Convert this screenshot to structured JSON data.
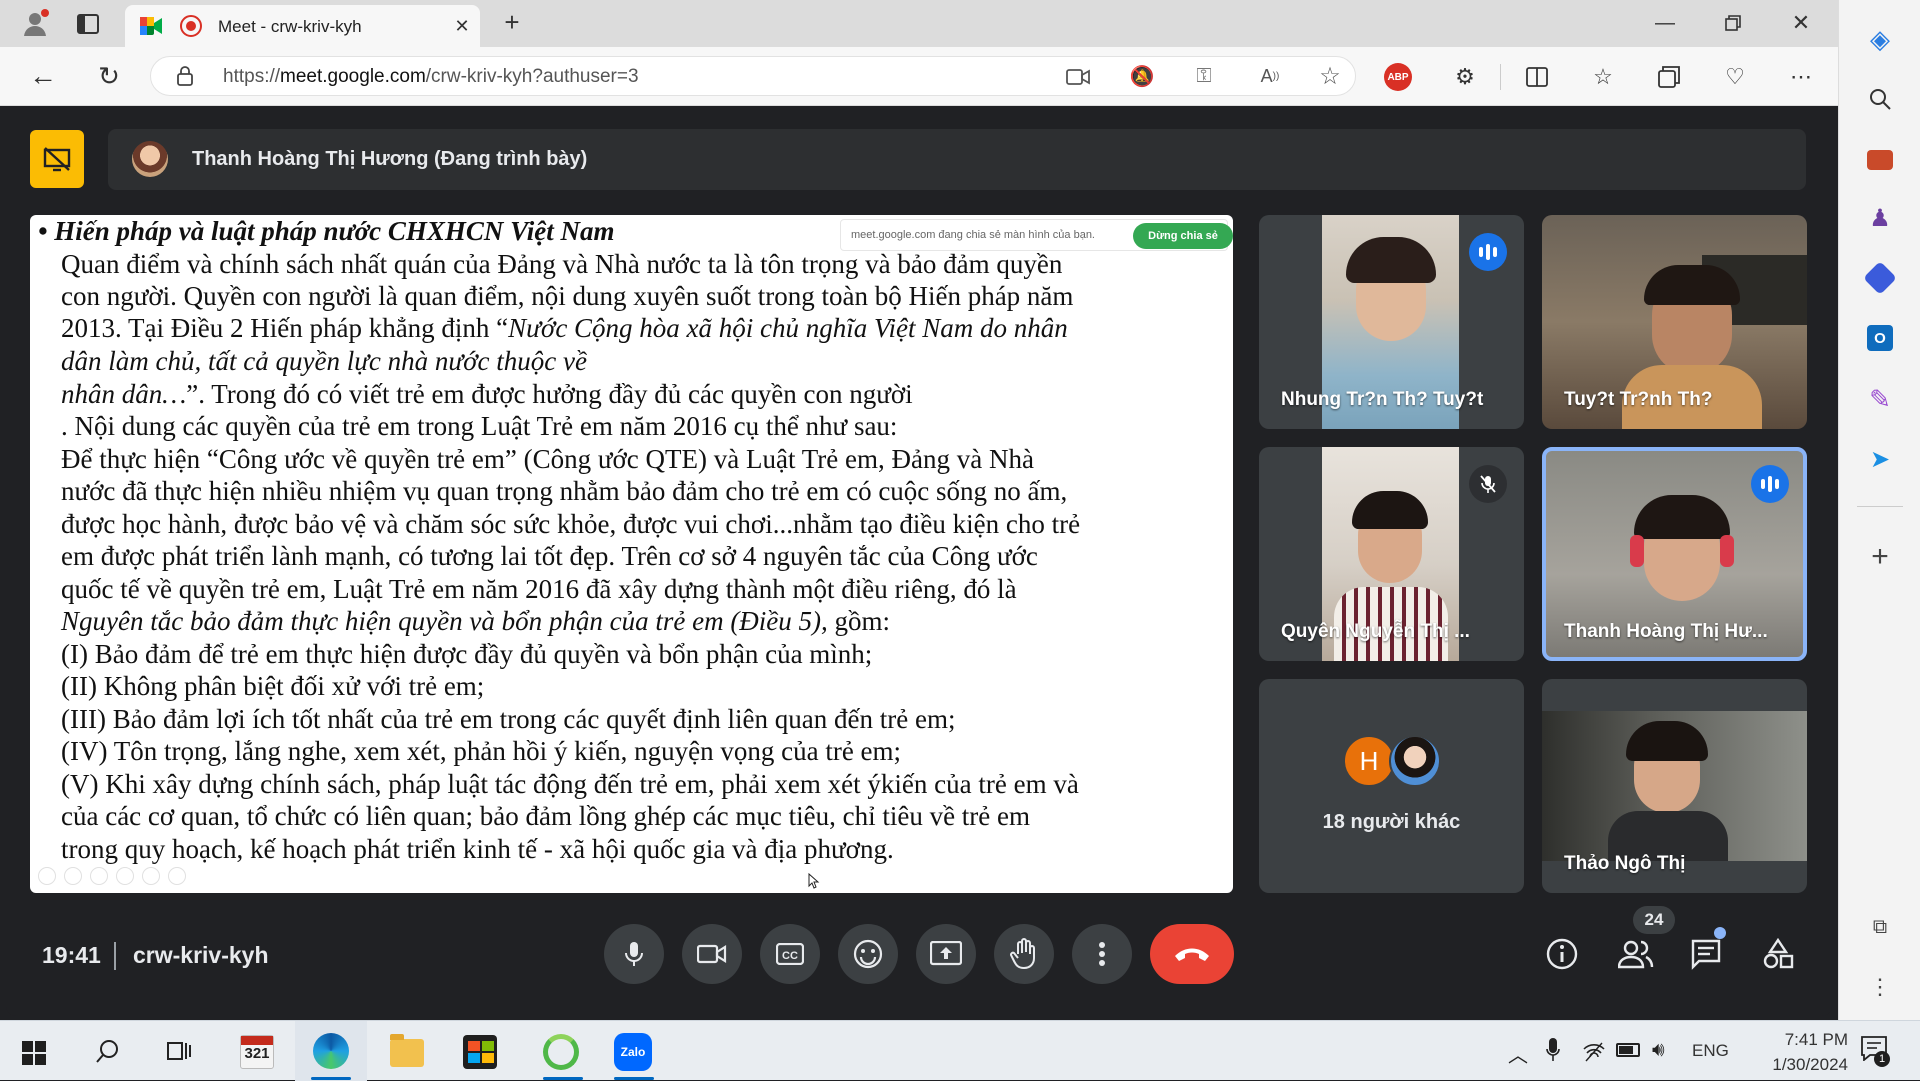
{
  "browser": {
    "tab_title": "Meet - crw-kriv-kyh",
    "url_prefix": "https://",
    "url_domain": "meet.google.com",
    "url_path": "/crw-kriv-kyh?authuser=3",
    "abp_badge": "ABP"
  },
  "presenter": {
    "name": "Thanh Hoàng Thị Hương (Đang trình bày)"
  },
  "share_notice": {
    "text": "meet.google.com đang chia sẻ màn hình của bạn.",
    "stop_label": "Dừng chia sẻ"
  },
  "slide": {
    "heading": "Hiến pháp và luật pháp nước CHXHCN Việt Nam",
    "line1": "Quan điểm và chính sách nhất quán của Đảng và Nhà nước ta là tôn trọng và bảo đảm quyền",
    "line2": "con người. Quyền con người là quan điểm, nội dung xuyên suốt trong toàn bộ Hiến pháp năm",
    "line3a": "2013. Tại Điều 2 Hiến pháp khẳng định “",
    "line3b": "Nước Cộng hòa xã hội chủ nghĩa Việt Nam do nhân",
    "line4": "dân làm chủ, tất cả quyền lực nhà nước thuộc về",
    "line5a": "nhân dân…",
    "line5b": "”. Trong đó có viết trẻ em được hưởng đầy đủ các quyền con người",
    "line6": ". Nội dung các quyền của trẻ em trong Luật Trẻ em năm 2016 cụ thể như sau:",
    "line7": "Để thực hiện “Công ước về quyền trẻ em” (Công ước QTE) và Luật Trẻ em, Đảng và Nhà",
    "line8": "nước đã thực hiện nhiều nhiệm vụ quan trọng nhằm bảo đảm cho trẻ em có cuộc sống no ấm,",
    "line9": "được học hành, được bảo vệ và chăm sóc sức khỏe, được vui chơi...nhằm tạo điều kiện cho trẻ",
    "line10": "em được phát triển lành mạnh, có tương lai tốt đẹp. Trên cơ sở 4 nguyên tắc của Công ước",
    "line11": "quốc tế về quyền trẻ em, Luật Trẻ em năm 2016 đã xây dựng thành một điều riêng, đó là",
    "line12a": "Nguyên tắc bảo đảm thực hiện quyền và bổn phận của trẻ em (Điều 5),",
    "line12b": " gồm:",
    "line13": "(I) Bảo đảm để trẻ em thực hiện được đầy đủ quyền và bổn phận của mình;",
    "line14": "(II) Không phân biệt đối xử với trẻ em;",
    "line15": "(III) Bảo đảm lợi ích tốt nhất của trẻ em trong các quyết định liên quan đến trẻ em;",
    "line16": "(IV) Tôn trọng, lắng nghe, xem xét, phản hồi ý kiến, nguyện vọng của trẻ em;",
    "line17": "(V) Khi xây dựng chính sách, pháp luật tác động đến trẻ em, phải xem xét ýkiến của trẻ em và",
    "line18": "của các cơ quan, tổ chức có liên quan; bảo đảm lồng ghép các mục tiêu, chỉ tiêu về trẻ em",
    "line19": "trong quy hoạch, kế hoạch phát triển kinh tế - xã hội quốc gia và địa phương."
  },
  "participants": [
    {
      "name": "Nhung Tr?n Th? Tuy?t",
      "state": "speaking"
    },
    {
      "name": "Tuy?t Tr?nh Th?",
      "state": "none"
    },
    {
      "name": "Quyên Nguyễn Thị ...",
      "state": "muted"
    },
    {
      "name": "Thanh Hoàng Thị Hư...",
      "state": "speaking"
    },
    {
      "name": "18 người khác",
      "state": "none",
      "avatar_letter": "H"
    },
    {
      "name": "Thảo Ngô Thị",
      "state": "none"
    }
  ],
  "meeting": {
    "time": "19:41",
    "code": "crw-kriv-kyh",
    "people_count": "24"
  },
  "colors": {
    "meet_bg": "#202124",
    "end_call": "#ea4335",
    "accent_blue": "#8ab4f8",
    "stop_share_green": "#34a853",
    "presenter_badge": "#fbbc04"
  },
  "taskbar": {
    "calendar_number": "321",
    "zalo_label": "Zalo",
    "lang": "ENG",
    "time": "7:41 PM",
    "date": "1/30/2024",
    "notif_count": "1"
  }
}
